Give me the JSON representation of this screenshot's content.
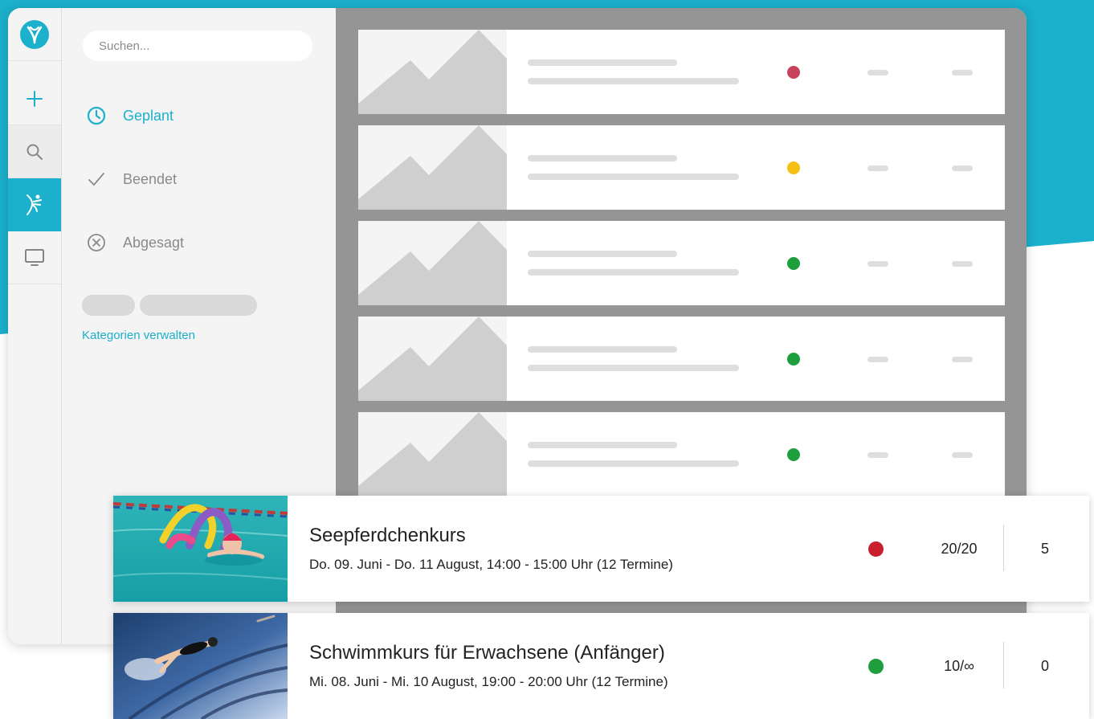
{
  "colors": {
    "accent": "#1bb0cc",
    "status_red": "#c81e2e",
    "status_yellow": "#f6bf14",
    "status_green": "#1e9e3c",
    "placeholder_red": "#c8425c"
  },
  "search": {
    "placeholder": "Suchen..."
  },
  "rail": {
    "items": [
      {
        "icon": "app-logo-icon"
      },
      {
        "icon": "plus-icon"
      },
      {
        "icon": "search-icon"
      },
      {
        "icon": "dancer-icon",
        "active": true
      },
      {
        "icon": "monitor-icon"
      }
    ]
  },
  "sidebar": {
    "filters": [
      {
        "label": "Geplant",
        "icon": "clock-icon",
        "active": true
      },
      {
        "label": "Beendet",
        "icon": "checkmark-icon",
        "active": false
      },
      {
        "label": "Abgesagt",
        "icon": "circle-x-icon",
        "active": false
      }
    ],
    "manage_categories": "Kategorien verwalten"
  },
  "placeholder_rows": [
    {
      "status": "red"
    },
    {
      "status": "yellow"
    },
    {
      "status": "green"
    },
    {
      "status": "green"
    },
    {
      "status": "green"
    }
  ],
  "courses": [
    {
      "title": "Seepferdchenkurs",
      "date": "Do. 09. Juni - Do. 11 August, 14:00 - 15:00 Uhr (12 Termine)",
      "status": "red",
      "capacity": "20/20",
      "waitlist": "5",
      "image": "children-swimming-pool-photo"
    },
    {
      "title": "Schwimmkurs für Erwachsene (Anfänger)",
      "date": "Mi. 08. Juni - Mi. 10 August, 19:00 - 20:00 Uhr (12 Termine)",
      "status": "green",
      "capacity": "10/∞",
      "waitlist": "0",
      "image": "adult-underwater-swimmer-photo"
    }
  ]
}
